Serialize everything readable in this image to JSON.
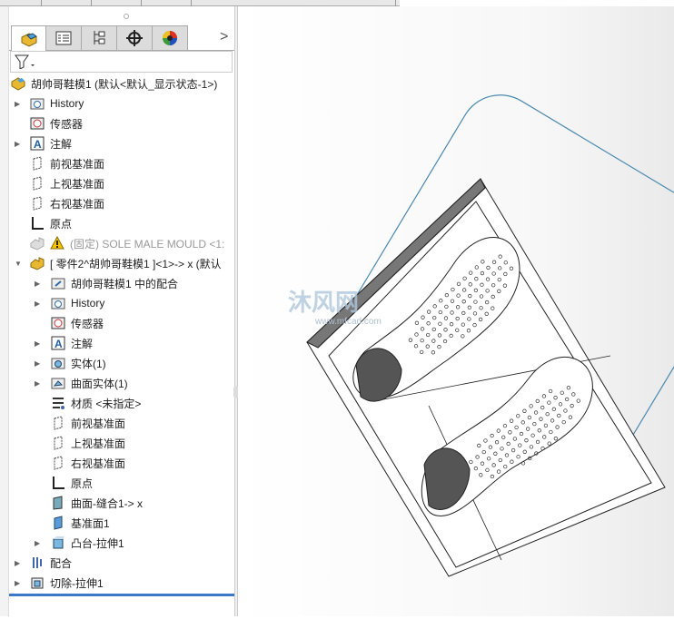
{
  "window": {
    "title": ""
  },
  "panel": {
    "tabs": [
      {
        "icon": "feature-manager-icon"
      },
      {
        "icon": "property-manager-icon"
      },
      {
        "icon": "configuration-manager-icon"
      },
      {
        "icon": "dimxpert-icon"
      },
      {
        "icon": "display-manager-icon"
      }
    ],
    "more_label": ">",
    "filter_icon": "filter-icon"
  },
  "tree": [
    {
      "level": 0,
      "expand": "",
      "icon": "assembly-icon",
      "label": "胡帅哥鞋模1  (默认<默认_显示状态-1>)"
    },
    {
      "level": 1,
      "expand": "right",
      "icon": "history-folder-icon",
      "label": "History"
    },
    {
      "level": 1,
      "expand": "",
      "icon": "sensor-icon",
      "label": "传感器"
    },
    {
      "level": 1,
      "expand": "right",
      "icon": "annotation-icon",
      "label": "注解"
    },
    {
      "level": 1,
      "expand": "",
      "icon": "plane-icon",
      "label": "前视基准面"
    },
    {
      "level": 1,
      "expand": "",
      "icon": "plane-icon",
      "label": "上视基准面"
    },
    {
      "level": 1,
      "expand": "",
      "icon": "plane-icon",
      "label": "右视基准面"
    },
    {
      "level": 1,
      "expand": "",
      "icon": "origin-icon",
      "label": "原点"
    },
    {
      "level": 1,
      "expand": "",
      "icon": "part-suppressed-icon",
      "label": "(固定) SOLE MALE MOULD <1:",
      "warn": true,
      "grey": true
    },
    {
      "level": 1,
      "expand": "down",
      "icon": "part-icon",
      "label": "[ 零件2^胡帅哥鞋模1 ]<1>-> x (默认"
    },
    {
      "level": 2,
      "expand": "right",
      "icon": "mates-folder-icon",
      "label": "胡帅哥鞋模1 中的配合"
    },
    {
      "level": 2,
      "expand": "right",
      "icon": "history-folder-icon",
      "label": "History"
    },
    {
      "level": 2,
      "expand": "",
      "icon": "sensor-icon",
      "label": "传感器"
    },
    {
      "level": 2,
      "expand": "right",
      "icon": "annotation-icon",
      "label": "注解"
    },
    {
      "level": 2,
      "expand": "right",
      "icon": "solid-body-icon",
      "label": "实体(1)"
    },
    {
      "level": 2,
      "expand": "right",
      "icon": "surface-body-icon",
      "label": "曲面实体(1)"
    },
    {
      "level": 2,
      "expand": "",
      "icon": "material-icon",
      "label": "材质 <未指定>"
    },
    {
      "level": 2,
      "expand": "",
      "icon": "plane-icon",
      "label": "前视基准面"
    },
    {
      "level": 2,
      "expand": "",
      "icon": "plane-icon",
      "label": "上视基准面"
    },
    {
      "level": 2,
      "expand": "",
      "icon": "plane-icon",
      "label": "右视基准面"
    },
    {
      "level": 2,
      "expand": "",
      "icon": "origin-icon",
      "label": "原点"
    },
    {
      "level": 2,
      "expand": "",
      "icon": "knit-surface-icon",
      "label": "曲面-缝合1-> x"
    },
    {
      "level": 2,
      "expand": "",
      "icon": "plane-blue-icon",
      "label": "基准面1"
    },
    {
      "level": 2,
      "expand": "right",
      "icon": "boss-extrude-icon",
      "label": "凸台-拉伸1"
    },
    {
      "level": 1,
      "expand": "right",
      "icon": "mates-icon",
      "label": "配合"
    },
    {
      "level": 1,
      "expand": "right",
      "icon": "cut-extrude-icon",
      "label": "切除-拉伸1"
    }
  ],
  "viewport": {
    "watermark": "沐风网",
    "watermark_url": "www.mfcad.com",
    "accent": "#3a78c8"
  }
}
